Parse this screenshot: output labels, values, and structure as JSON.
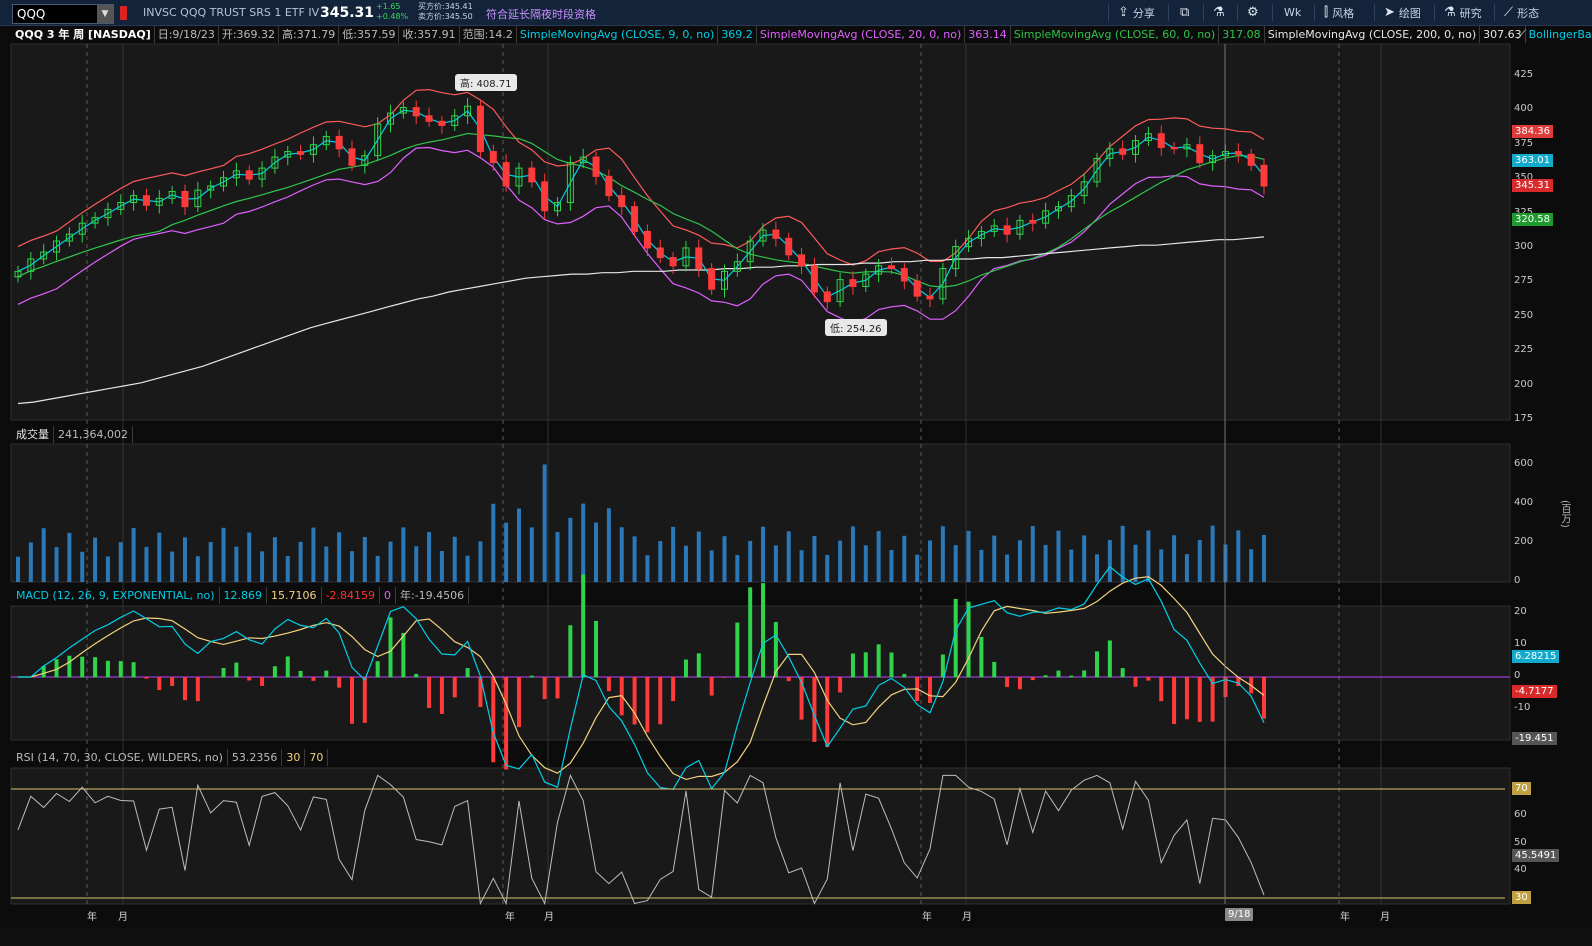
{
  "toolbar": {
    "symbol": "QQQ",
    "description": "INVSC QQQ TRUST SRS 1 ETF IV",
    "last_price": "345.31",
    "change_abs": "+1.65",
    "change_pct": "+0.48%",
    "bid": "买方价:345.41",
    "ask": "卖方价:345.50",
    "notice": "符合延长隔夜时段资格",
    "buttons": {
      "share": "分享",
      "style": "风格",
      "draw": "绘图",
      "studies": "研究",
      "patterns": "形态",
      "aggregation": "Wk"
    }
  },
  "legend": {
    "symbol_period": "QQQ 3 年 周 [NASDAQ]",
    "date": "日:9/18/23",
    "open": "开:369.32",
    "high": "高:371.79",
    "low": "低:357.59",
    "close": "收:357.91",
    "range": "范围:14.2",
    "sma9_label": "SimpleMovingAvg (CLOSE, 9, 0, no)",
    "sma9_value": "369.2",
    "sma20_label": "SimpleMovingAvg (CLOSE, 20, 0, no)",
    "sma20_value": "363.14",
    "sma60_label": "SimpleMovingAvg (CLOSE, 60, 0, no)",
    "sma60_value": "317.08",
    "sma200_label": "SimpleMovingAvg (CLOSE, 200, 0, no)",
    "sma200_value": "307.63",
    "bb_label": "BollingerBands ..."
  },
  "price_axis": {
    "ticks": [
      "425",
      "400",
      "375",
      "350",
      "325",
      "300",
      "275",
      "250",
      "225",
      "200",
      "175"
    ],
    "tags": [
      {
        "text": "384.36",
        "color": "#e03a3a"
      },
      {
        "text": "363.01",
        "color": "#11aacc"
      },
      {
        "text": "345.31",
        "color": "#d82a2a"
      },
      {
        "text": "320.58",
        "color": "#1e9a2e"
      }
    ]
  },
  "callouts": {
    "high": "高: 408.71",
    "low": "低: 254.26"
  },
  "volume": {
    "title": "成交量",
    "value": "241,364,002",
    "ticks": [
      "600",
      "400",
      "200",
      "0"
    ],
    "unit": "(百万)"
  },
  "macd": {
    "label": "MACD (12, 26, 9, EXPONENTIAL, no)",
    "value": "12.869",
    "avg": "15.7106",
    "diff": "-2.84159",
    "zero": "0",
    "annual": "年:-19.4506",
    "ticks": [
      "20",
      "10",
      "0",
      "-10"
    ],
    "tags": [
      {
        "text": "6.28215",
        "color": "#11aacc"
      },
      {
        "text": "-4.7177",
        "color": "#d82a2a"
      },
      {
        "text": "-19.451",
        "color": "#555555"
      }
    ]
  },
  "rsi": {
    "label": "RSI (14, 70, 30, CLOSE, WILDERS, no)",
    "value": "53.2356",
    "ob": "30",
    "os": "70",
    "ticks": [
      "60",
      "50",
      "40"
    ],
    "tags": [
      {
        "text": "70",
        "color": "#c0a040"
      },
      {
        "text": "45.5491",
        "color": "#555555"
      },
      {
        "text": "30",
        "color": "#c0a040"
      }
    ]
  },
  "time_axis": {
    "labels": [
      "年",
      "月",
      "年",
      "月",
      "年",
      "月",
      "年",
      "月"
    ],
    "current": "9/18"
  },
  "colors": {
    "up": "#2fd44a",
    "down": "#ff3a3a",
    "sma9": "#00cfe8",
    "sma20": "#e060ff",
    "sma60": "#2fc44a",
    "sma200": "#e6e6e6",
    "bb": "#ff5a5a",
    "volume": "#2a78b8"
  },
  "chart_data": {
    "type": "line",
    "title": "QQQ 3 年 周 [NASDAQ]",
    "ylim": [
      175,
      430
    ],
    "price_close": [
      283,
      292,
      297,
      305,
      310,
      318,
      322,
      328,
      333,
      338,
      331,
      336,
      341,
      330,
      342,
      345,
      351,
      356,
      350,
      358,
      366,
      370,
      368,
      375,
      381,
      372,
      360,
      367,
      390,
      398,
      402,
      396,
      392,
      389,
      396,
      403,
      370,
      362,
      345,
      358,
      348,
      327,
      333,
      362,
      366,
      352,
      338,
      330,
      312,
      300,
      293,
      287,
      300,
      285,
      270,
      283,
      290,
      305,
      313,
      307,
      295,
      287,
      268,
      261,
      277,
      272,
      281,
      287,
      285,
      276,
      265,
      263,
      285,
      301,
      307,
      312,
      316,
      310,
      320,
      318,
      327,
      330,
      338,
      348,
      365,
      372,
      368,
      378,
      383,
      373,
      372,
      375,
      362,
      367,
      370,
      368,
      360,
      345
    ],
    "sma200": [
      187,
      188,
      190,
      192,
      194,
      196,
      198,
      200,
      202,
      205,
      208,
      211,
      214,
      218,
      222,
      226,
      230,
      234,
      238,
      242,
      245,
      248,
      251,
      254,
      257,
      260,
      263,
      265,
      268,
      270,
      272,
      274,
      276,
      278,
      279,
      280,
      281,
      281,
      282,
      282,
      283,
      283,
      283,
      284,
      284,
      284,
      285,
      285,
      286,
      286,
      287,
      287,
      288,
      288,
      288,
      289,
      289,
      290,
      290,
      291,
      291,
      292,
      292,
      293,
      293,
      294,
      295,
      296,
      297,
      298,
      299,
      300,
      301,
      302,
      302,
      303,
      304,
      305,
      306,
      306,
      307,
      308
    ]
  }
}
